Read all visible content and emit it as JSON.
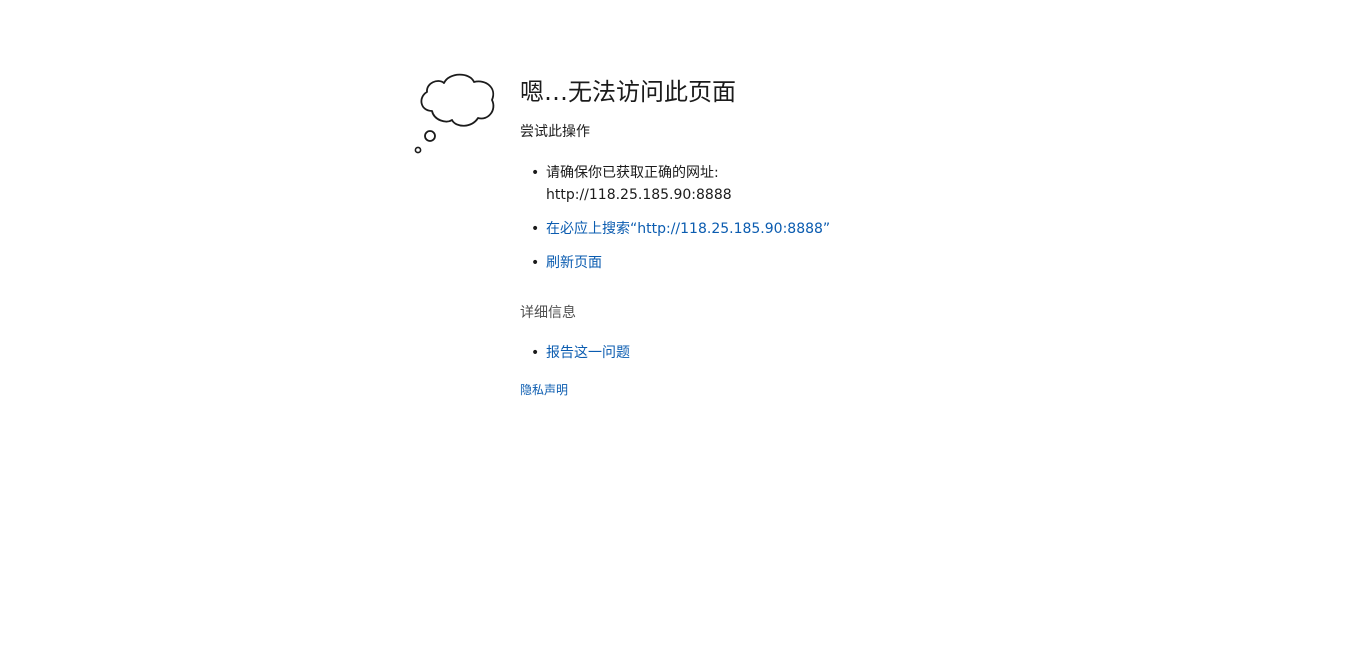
{
  "icon": "thought-cloud-icon",
  "title": "嗯…无法访问此页面",
  "subtitle": "尝试此操作",
  "suggestions": {
    "ensure_address_label": "请确保你已获取正确的网址:",
    "address": "http://118.25.185.90:8888",
    "search_link": "在必应上搜索“http://118.25.185.90:8888”",
    "refresh_link": "刷新页面"
  },
  "details": {
    "heading": "详细信息",
    "report_link": "报告这一问题"
  },
  "privacy_link": "隐私声明",
  "colors": {
    "link": "#0b5cb0",
    "text": "#1b1b1b",
    "muted": "#505050",
    "background": "#ffffff"
  }
}
